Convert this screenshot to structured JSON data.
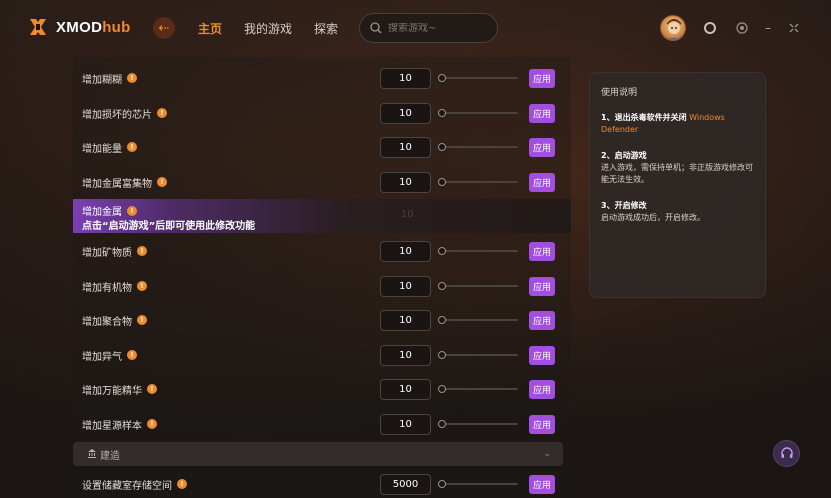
{
  "app": {
    "logo_main": "XMOD",
    "logo_accent": "hub"
  },
  "nav": [
    {
      "label": "主页",
      "active": true
    },
    {
      "label": "我的游戏",
      "active": false
    },
    {
      "label": "探索",
      "active": false
    }
  ],
  "search": {
    "placeholder": "搜索游戏~"
  },
  "rows": [
    {
      "label": "增加糊糊",
      "value": "10",
      "apply": "应用",
      "slider": 0.0
    },
    {
      "label": "增加损坏的芯片",
      "value": "10",
      "apply": "应用",
      "slider": 0.0
    },
    {
      "label": "增加能量",
      "value": "10",
      "apply": "应用",
      "slider": 0.0
    },
    {
      "label": "增加金属富集物",
      "value": "10",
      "apply": "应用",
      "slider": 0.0
    },
    {
      "label": "增加矿物质",
      "value": "10",
      "apply": "应用",
      "slider": 0.0
    },
    {
      "label": "增加有机物",
      "value": "10",
      "apply": "应用",
      "slider": 0.0
    },
    {
      "label": "增加聚合物",
      "value": "10",
      "apply": "应用",
      "slider": 0.0
    },
    {
      "label": "增加异气",
      "value": "10",
      "apply": "应用",
      "slider": 0.0
    },
    {
      "label": "增加万能精华",
      "value": "10",
      "apply": "应用",
      "slider": 0.0
    },
    {
      "label": "增加星源样本",
      "value": "10",
      "apply": "应用",
      "slider": 0.0
    }
  ],
  "highlight_row": {
    "label": "增加金属",
    "message": "点击“启动游戏”后即可使用此修改功能",
    "ghost_value": "10"
  },
  "section": {
    "label": "建造"
  },
  "last_row": {
    "label": "设置储藏室存储空间",
    "value": "5000",
    "apply": "应用",
    "slider": 0.0
  },
  "instructions": {
    "title": "使用说明",
    "step1_head": "1、退出杀毒软件并关闭",
    "step1_highlight": "Windows Defender",
    "step2_head": "2、启动游戏",
    "step2_body": "进入游戏，需保持单机；非正版游戏修改可能无法生效。",
    "step3_head": "3、开启修改",
    "step3_body": "启动游戏成功后，开启修改。"
  },
  "colors": {
    "accent": "#f08a2c",
    "apply": "#a24fe0",
    "highlight": "#7b3fb3"
  },
  "icons": [
    "logo-icon",
    "back-icon",
    "search-icon",
    "avatar",
    "shirt-icon",
    "target-icon",
    "minimize-icon",
    "close-icon",
    "info-icon",
    "building-icon",
    "chevron-down-icon",
    "headset-icon"
  ]
}
